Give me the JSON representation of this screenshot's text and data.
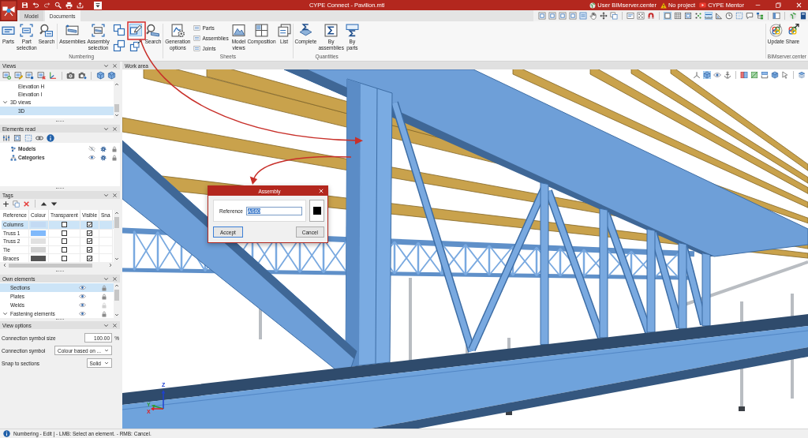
{
  "title_bar": {
    "title": "CYPE Connect - Pavilion.mtl",
    "user": "User BIMserver.center",
    "project": "No project",
    "mentor": "CYPE Mentor"
  },
  "tabs": [
    {
      "label": "Model",
      "selected": false
    },
    {
      "label": "Documents",
      "selected": true
    }
  ],
  "display_toolbar": [
    {
      "selected": false
    },
    {
      "selected": false
    },
    {
      "selected": false
    },
    {
      "selected": false
    },
    {
      "selected": false
    },
    {
      "selected": false
    },
    {
      "selected": false
    },
    {
      "selected": false
    },
    {
      "selected": false
    },
    {
      "selected": false
    },
    {
      "selected": false
    },
    {
      "selected": true
    },
    {
      "selected": false
    },
    {
      "selected": false
    },
    {
      "selected": false
    },
    {
      "selected": true
    },
    {
      "selected": false
    },
    {
      "selected": false
    },
    {
      "selected": false
    },
    {
      "selected": false
    },
    {
      "selected": false
    },
    {
      "selected": false
    },
    {
      "selected": false
    },
    {
      "selected": false
    }
  ],
  "ribbon": [
    {
      "label": "Numbering",
      "items": [
        {
          "kind": "large",
          "label": "Parts"
        },
        {
          "kind": "large",
          "label": "Part selection"
        },
        {
          "kind": "large",
          "label": "Search"
        },
        {
          "kind": "separator"
        },
        {
          "kind": "large",
          "label": "Assemblies"
        },
        {
          "kind": "large",
          "label": "Assembly selection"
        },
        {
          "kind": "grid",
          "tools": [
            {
              "selected": false
            },
            {
              "selected": true
            },
            {
              "selected": false
            },
            {
              "selected": false
            }
          ]
        },
        {
          "kind": "large",
          "label": "Search"
        }
      ]
    },
    {
      "label": "Sheets",
      "items": [
        {
          "kind": "large",
          "label": "Generation options"
        },
        {
          "kind": "stack",
          "entries": [
            "Parts",
            "Assemblies",
            "Joints"
          ]
        },
        {
          "kind": "large",
          "label": "Model views"
        },
        {
          "kind": "large",
          "label": "Composition"
        },
        {
          "kind": "large",
          "label": "List"
        }
      ]
    },
    {
      "label": "Quantities",
      "items": [
        {
          "kind": "large",
          "label": "Complete"
        },
        {
          "kind": "large",
          "label": "By assemblies"
        },
        {
          "kind": "large",
          "label": "By parts"
        }
      ]
    },
    {
      "label": "BIMserver.center",
      "items": [
        {
          "kind": "large",
          "label": "Update"
        },
        {
          "kind": "large",
          "label": "Share"
        }
      ]
    }
  ],
  "views_panel": {
    "title": "Views",
    "tree": [
      {
        "children": [
          {
            "label": "Elevation H",
            "selected": false
          },
          {
            "label": "Elevation I",
            "selected": false
          }
        ]
      },
      {
        "label": "3D views",
        "expanded": true,
        "selected": false,
        "children": [
          {
            "label": "3D",
            "selected": true
          }
        ]
      }
    ]
  },
  "elements_panel": {
    "title": "Elements read",
    "rows": [
      {
        "label": "Models",
        "visible": false,
        "selected": false
      },
      {
        "label": "Categories",
        "visible": true,
        "selected": false
      }
    ]
  },
  "tags_panel": {
    "title": "Tags",
    "columns": [
      "Reference",
      "Colour",
      "Transparent",
      "Visible",
      "Sna"
    ],
    "rows": [
      {
        "reference": "Columns",
        "color": "#c3daf3",
        "transparent": false,
        "visible": true,
        "selected": true
      },
      {
        "reference": "Truss 1",
        "color": "#80b9fb",
        "transparent": false,
        "visible": true,
        "selected": false
      },
      {
        "reference": "Truss 2",
        "color": "#e1e1e1",
        "transparent": false,
        "visible": true,
        "selected": false
      },
      {
        "reference": "Tie",
        "color": "#d2d2d2",
        "transparent": false,
        "visible": true,
        "selected": false
      },
      {
        "reference": "Braces",
        "color": "#555555",
        "transparent": false,
        "visible": true,
        "selected": false
      }
    ]
  },
  "own_elements": {
    "title": "Own elements",
    "rows": [
      {
        "kind": "item",
        "label": "Sections",
        "selected": true,
        "lock_disabled": false
      },
      {
        "kind": "item",
        "label": "Plates",
        "selected": false,
        "lock_disabled": false
      },
      {
        "kind": "item",
        "label": "Welds",
        "selected": false,
        "lock_disabled": true
      },
      {
        "kind": "group",
        "label": "Fastening elements",
        "expanded": true,
        "selected": false,
        "lock_disabled": false
      }
    ]
  },
  "view_options": {
    "title": "View options",
    "fields": [
      {
        "kind": "number",
        "label": "Connection symbol size",
        "value": "100.00",
        "unit": "%"
      },
      {
        "kind": "select",
        "label": "Connection symbol",
        "value": "Colour based on ..."
      },
      {
        "kind": "select",
        "label": "Snap to sections",
        "value": "Solid"
      }
    ]
  },
  "work_area": {
    "title": "Work area",
    "view_toolbar": [
      {
        "selected": false
      },
      {
        "selected": true
      },
      {
        "selected": false
      },
      {
        "selected": false
      },
      {
        "selected": false
      },
      {
        "selected": false
      },
      {
        "selected": false
      },
      {
        "selected": false
      },
      {
        "selected": false
      },
      {
        "selected": false
      }
    ],
    "axes": [
      "Z",
      "Y",
      "X"
    ]
  },
  "dialog": {
    "title": "Assembly",
    "reference_label": "Reference",
    "reference_value": "AS60",
    "value_selected": true,
    "color": "#000000",
    "buttons": [
      {
        "label": "Accept",
        "default": true
      },
      {
        "label": "Cancel",
        "default": false
      }
    ]
  },
  "status_bar": {
    "text": "Numbering - Edit | - LMB: Select an element. - RMB: Cancel."
  }
}
